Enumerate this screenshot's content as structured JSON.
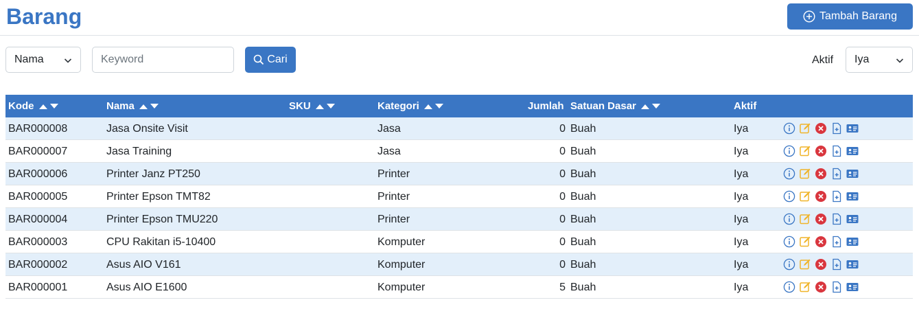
{
  "header": {
    "title": "Barang",
    "add_button_label": "Tambah Barang"
  },
  "filter": {
    "field_select_value": "Nama",
    "keyword_placeholder": "Keyword",
    "keyword_value": "",
    "search_button_label": "Cari",
    "active_label": "Aktif",
    "active_select_value": "Iya"
  },
  "table": {
    "columns": [
      "Kode",
      "Nama",
      "SKU",
      "Kategori",
      "Jumlah",
      "Satuan Dasar",
      "Aktif"
    ],
    "rows": [
      {
        "kode": "BAR000008",
        "nama": "Jasa Onsite Visit",
        "sku": "",
        "kategori": "Jasa",
        "jumlah": "0",
        "satuan": "Buah",
        "aktif": "Iya"
      },
      {
        "kode": "BAR000007",
        "nama": "Jasa Training",
        "sku": "",
        "kategori": "Jasa",
        "jumlah": "0",
        "satuan": "Buah",
        "aktif": "Iya"
      },
      {
        "kode": "BAR000006",
        "nama": "Printer Janz PT250",
        "sku": "",
        "kategori": "Printer",
        "jumlah": "0",
        "satuan": "Buah",
        "aktif": "Iya"
      },
      {
        "kode": "BAR000005",
        "nama": "Printer Epson TMT82",
        "sku": "",
        "kategori": "Printer",
        "jumlah": "0",
        "satuan": "Buah",
        "aktif": "Iya"
      },
      {
        "kode": "BAR000004",
        "nama": "Printer Epson TMU220",
        "sku": "",
        "kategori": "Printer",
        "jumlah": "0",
        "satuan": "Buah",
        "aktif": "Iya"
      },
      {
        "kode": "BAR000003",
        "nama": "CPU Rakitan i5-10400",
        "sku": "",
        "kategori": "Komputer",
        "jumlah": "0",
        "satuan": "Buah",
        "aktif": "Iya"
      },
      {
        "kode": "BAR000002",
        "nama": "Asus AIO V161",
        "sku": "",
        "kategori": "Komputer",
        "jumlah": "0",
        "satuan": "Buah",
        "aktif": "Iya"
      },
      {
        "kode": "BAR000001",
        "nama": "Asus AIO E1600",
        "sku": "",
        "kategori": "Komputer",
        "jumlah": "5",
        "satuan": "Buah",
        "aktif": "Iya"
      }
    ],
    "row_actions": [
      "info-icon",
      "edit-icon",
      "delete-icon",
      "add-file-icon",
      "id-card-icon"
    ]
  },
  "colors": {
    "primary": "#3a76c4",
    "stripe": "#e3effa",
    "edit": "#f0b429",
    "delete": "#d9363e"
  }
}
